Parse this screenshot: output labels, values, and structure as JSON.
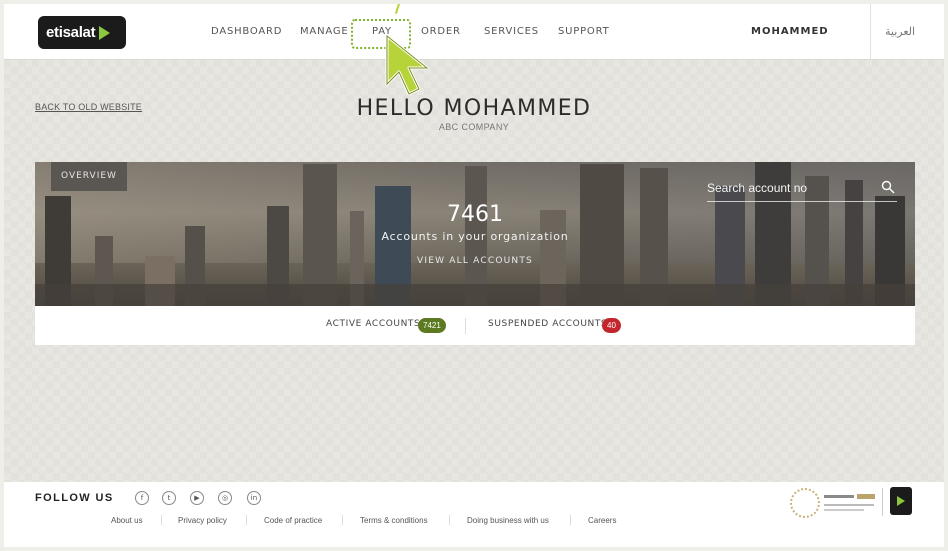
{
  "header": {
    "logo_text": "etisalat",
    "nav": [
      "DASHBOARD",
      "MANAGE",
      "PAY",
      "ORDER",
      "SERVICES",
      "SUPPORT"
    ],
    "user_name": "MOHAMMED",
    "language": "العربية",
    "highlighted_item": "PAY"
  },
  "greeting": {
    "back_link": "BACK TO OLD WEBSITE",
    "title": "HELLO MOHAMMED",
    "company": "ABC COMPANY"
  },
  "overview": {
    "tab_label": "OVERVIEW",
    "search_placeholder": "Search account no",
    "account_count": "7461",
    "account_count_label": "Accounts in your organization",
    "view_all_label": "VIEW ALL ACCOUNTS"
  },
  "stats": {
    "active_label": "ACTIVE ACCOUNTS",
    "active_count": "7421",
    "suspended_label": "SUSPENDED ACCOUNTS",
    "suspended_count": "40"
  },
  "footer": {
    "follow_label": "FOLLOW US",
    "social_icons": [
      "facebook-icon",
      "twitter-icon",
      "youtube-icon",
      "instagram-icon",
      "linkedin-icon"
    ],
    "links": [
      "About us",
      "Privacy policy",
      "Code of practice",
      "Terms & conditions",
      "Doing business with us",
      "Careers"
    ]
  },
  "colors": {
    "brand_black": "#1b1b1b",
    "brand_green": "#8dc63f",
    "active_badge": "#5c7a21",
    "suspended_badge": "#c1272d"
  }
}
